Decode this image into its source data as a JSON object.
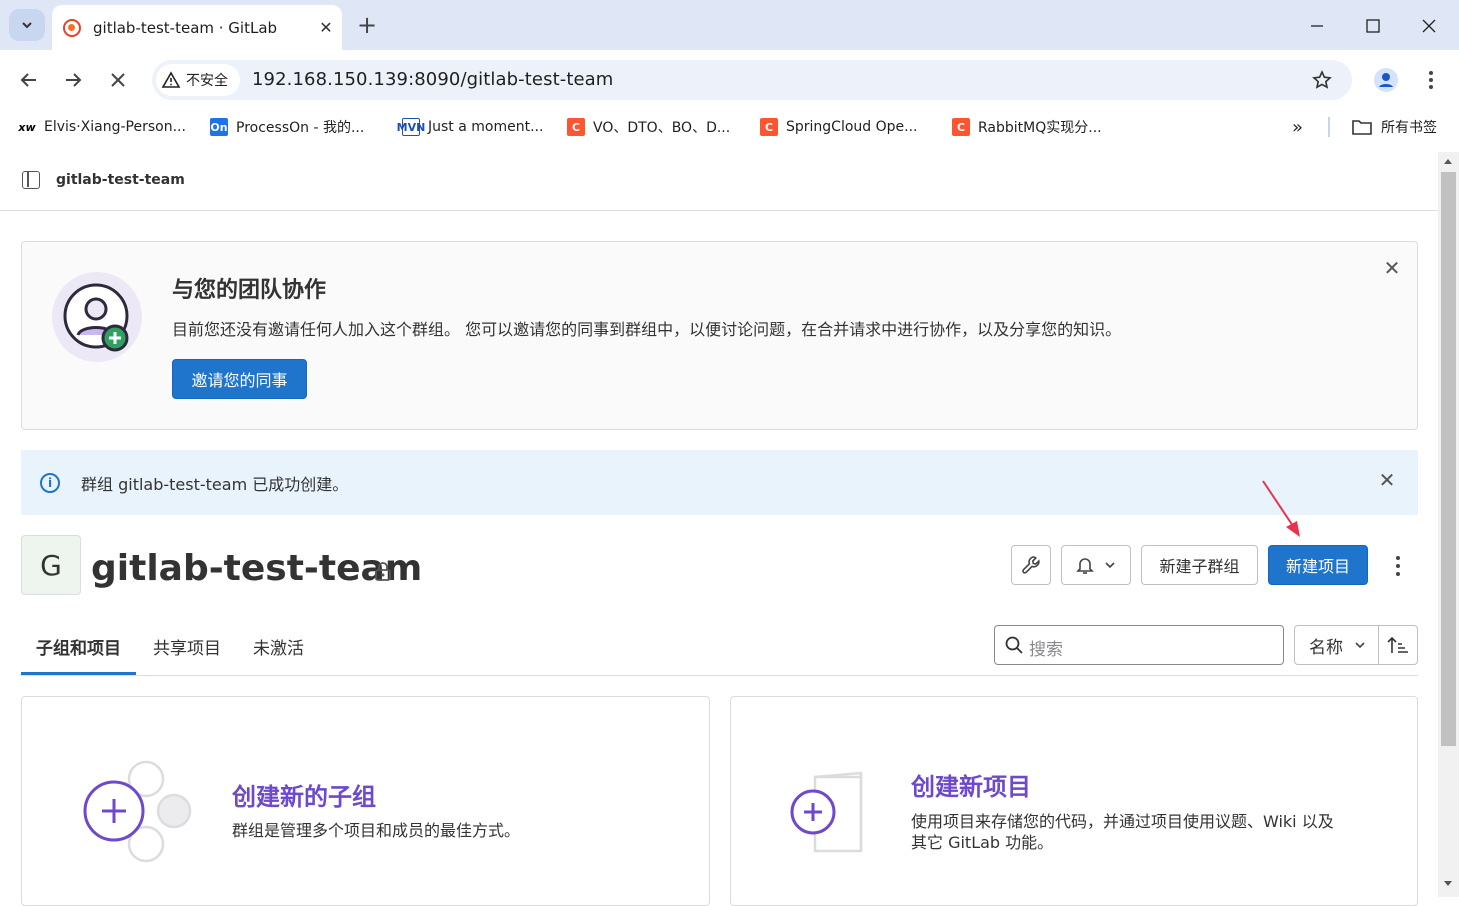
{
  "browser": {
    "tab_title": "gitlab-test-team · GitLab",
    "new_tab": "+",
    "insecure_label": "不安全",
    "url": "192.168.150.139:8090/gitlab-test-team",
    "bookmarks": [
      {
        "icon": "xw",
        "label": "Elvis·Xiang-Person..."
      },
      {
        "icon": "On",
        "label": "ProcessOn - 我的..."
      },
      {
        "icon": "MVN",
        "label": "Just a moment..."
      },
      {
        "icon": "C",
        "label": "VO、DTO、BO、D..."
      },
      {
        "icon": "C",
        "label": "SpringCloud Ope..."
      },
      {
        "icon": "C",
        "label": "RabbitMQ实现分..."
      }
    ],
    "bookmarks_overflow": "»",
    "all_bookmarks": "所有书签"
  },
  "breadcrumb": {
    "group": "gitlab-test-team"
  },
  "invite_banner": {
    "title": "与您的团队协作",
    "description": "目前您还没有邀请任何人加入这个群组。 您可以邀请您的同事到群组中，以便讨论问题，在合并请求中进行协作，以及分享您的知识。",
    "button": "邀请您的同事"
  },
  "alert": {
    "message": "群组 gitlab-test-team 已成功创建。"
  },
  "group": {
    "avatar_letter": "G",
    "name": "gitlab-test-team",
    "new_subgroup_button": "新建子群组",
    "new_project_button": "新建项目"
  },
  "tabs": [
    "子组和项目",
    "共享项目",
    "未激活"
  ],
  "search": {
    "placeholder": "搜索"
  },
  "sort": {
    "label": "名称"
  },
  "cards": {
    "subgroup": {
      "title": "创建新的子组",
      "description": "群组是管理多个项目和成员的最佳方式。"
    },
    "project": {
      "title": "创建新项目",
      "description_line1": "使用项目来存储您的代码，并通过项目使用议题、Wiki 以及",
      "description_line2": "其它 GitLab 功能。"
    }
  },
  "colors": {
    "primary": "#1f75cb",
    "accent_purple": "#6e49cb",
    "alert_bg": "#e9f3fc",
    "annotation_arrow": "#e8334f"
  }
}
